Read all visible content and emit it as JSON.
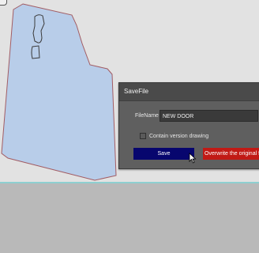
{
  "dialog": {
    "title": "SaveFile",
    "filename_label": "FileName",
    "filename_value": "NEW DOOR",
    "checkbox_label": "Contain version drawing",
    "checkbox_checked": false,
    "save_label": "Save",
    "overwrite_label": "Overwrite the original file"
  },
  "colors": {
    "canvas_bg": "#e2e2e2",
    "door_fill": "#b8cde9",
    "door_outline": "#a25c63",
    "save_button": "#07066e",
    "overwrite_button": "#c11a15",
    "dialog_bg": "#5f5f5f",
    "guide_line": "#8ecfd0"
  },
  "icons": {
    "cursor": "mouse-pointer-icon",
    "corner": "canvas-corner-icon"
  }
}
